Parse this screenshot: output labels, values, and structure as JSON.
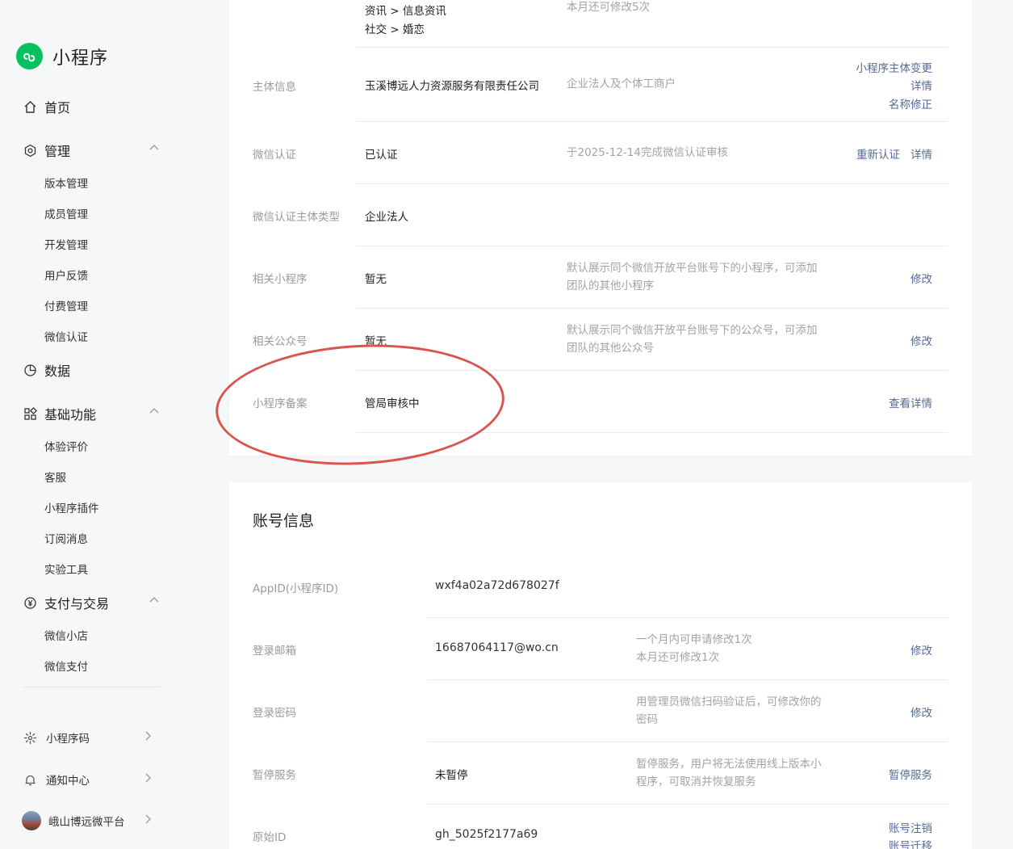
{
  "sidebar": {
    "app_name": "小程序",
    "home": "首页",
    "manage": {
      "label": "管理",
      "items": [
        "版本管理",
        "成员管理",
        "开发管理",
        "用户反馈",
        "付费管理",
        "微信认证"
      ]
    },
    "data": "数据",
    "basic": {
      "label": "基础功能",
      "items": [
        "体验评价",
        "客服",
        "小程序插件",
        "订阅消息",
        "实验工具"
      ]
    },
    "pay": {
      "label": "支付与交易",
      "items": [
        "微信小店",
        "微信支付"
      ]
    },
    "bottom": {
      "qrcode": "小程序码",
      "notice": "通知中心",
      "account": "峨山博远微平台"
    }
  },
  "basic_info": {
    "category": {
      "line1": "资讯 > 信息资讯",
      "line2": "社交 > 婚恋",
      "desc": "本月还可修改5次"
    },
    "subject": {
      "label": "主体信息",
      "value": "玉溪博远人力资源服务有限责任公司",
      "desc": "企业法人及个体工商户",
      "links": [
        "小程序主体变更",
        "详情",
        "名称修正"
      ]
    },
    "wechat_verify": {
      "label": "微信认证",
      "value": "已认证",
      "desc": "于2025-12-14完成微信认证审核",
      "links": [
        "重新认证",
        "详情"
      ]
    },
    "verify_type": {
      "label": "微信认证主体类型",
      "value": "企业法人"
    },
    "related_mp": {
      "label": "相关小程序",
      "value": "暂无",
      "desc1": "默认展示同个微信开放平台账号下的小程序，可添加",
      "desc2": "团队的其他小程序",
      "link": "修改"
    },
    "related_oa": {
      "label": "相关公众号",
      "value": "暂无",
      "desc1": "默认展示同个微信开放平台账号下的公众号，可添加",
      "desc2": "团队的其他公众号",
      "link": "修改"
    },
    "filing": {
      "label": "小程序备案",
      "value": "管局审核中",
      "link": "查看详情"
    }
  },
  "account_info": {
    "title": "账号信息",
    "appid": {
      "label": "AppID(小程序ID)",
      "value": "wxf4a02a72d678027f"
    },
    "email": {
      "label": "登录邮箱",
      "value": "16687064117@wo.cn",
      "desc1": "一个月内可申请修改1次",
      "desc2": "本月还可修改1次",
      "link": "修改"
    },
    "password": {
      "label": "登录密码",
      "desc1": "用管理员微信扫码验证后，可修改你的",
      "desc2": "密码",
      "link": "修改"
    },
    "pause": {
      "label": "暂停服务",
      "value": "未暂停",
      "desc1": "暂停服务，用户将无法使用线上版本小",
      "desc2": "程序，可取消并恢复服务",
      "link": "暂停服务"
    },
    "origin": {
      "label": "原始ID",
      "value": "gh_5025f2177a69",
      "links": [
        "账号注销",
        "账号迁移"
      ]
    }
  },
  "colors": {
    "brand": "#07c160",
    "link": "#576b95",
    "annotation": "#d9534f"
  }
}
